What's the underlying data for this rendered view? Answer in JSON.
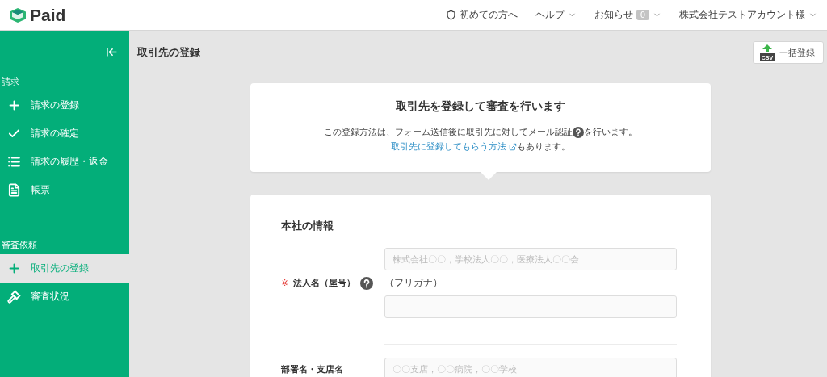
{
  "header": {
    "logo": "Paid",
    "links": [
      {
        "kind": "guide",
        "label": "初めての方へ"
      },
      {
        "kind": "menu",
        "label": "ヘルプ"
      },
      {
        "kind": "badge_menu",
        "label": "お知らせ",
        "badge": "0"
      },
      {
        "kind": "menu",
        "label": "株式会社テストアカウント様"
      }
    ]
  },
  "sidebar": {
    "sections": [
      {
        "title": "請求",
        "items": [
          {
            "kind": "plus",
            "label": "請求の登録",
            "selected": false
          },
          {
            "kind": "check",
            "label": "請求の確定",
            "selected": false
          },
          {
            "kind": "list",
            "label": "請求の履歴・返金",
            "selected": false
          },
          {
            "kind": "document",
            "label": "帳票",
            "selected": false
          }
        ]
      },
      {
        "title": "審査依頼",
        "items": [
          {
            "kind": "plus",
            "label": "取引先の登録",
            "selected": true
          },
          {
            "kind": "gavel",
            "label": "審査状況",
            "selected": false
          }
        ]
      }
    ]
  },
  "page": {
    "title": "取引先の登録",
    "bulk_button": {
      "label": "一括登録",
      "icon_text": "CSV"
    }
  },
  "intro": {
    "title": "取引先を登録して審査を行います",
    "line1_before": "この登録方法は、フォーム送信後に取引先に対してメール認証",
    "line1_after": "を行います。",
    "link": "取引先に登録してもらう方法",
    "line2_after": "もあります。"
  },
  "form": {
    "section_title": "本社の情報",
    "fields": [
      {
        "mark": "※",
        "label": "法人名（屋号）",
        "help": true,
        "inputs": [
          {
            "placeholder": "株式会社〇〇，学校法人〇〇，医療法人〇〇会"
          },
          {
            "caption": "（フリガナ）"
          }
        ]
      },
      {
        "label": "部署名・支店名",
        "help": false,
        "inputs": [
          {
            "placeholder": "〇〇支店，〇〇病院，〇〇学校"
          }
        ]
      }
    ]
  }
}
